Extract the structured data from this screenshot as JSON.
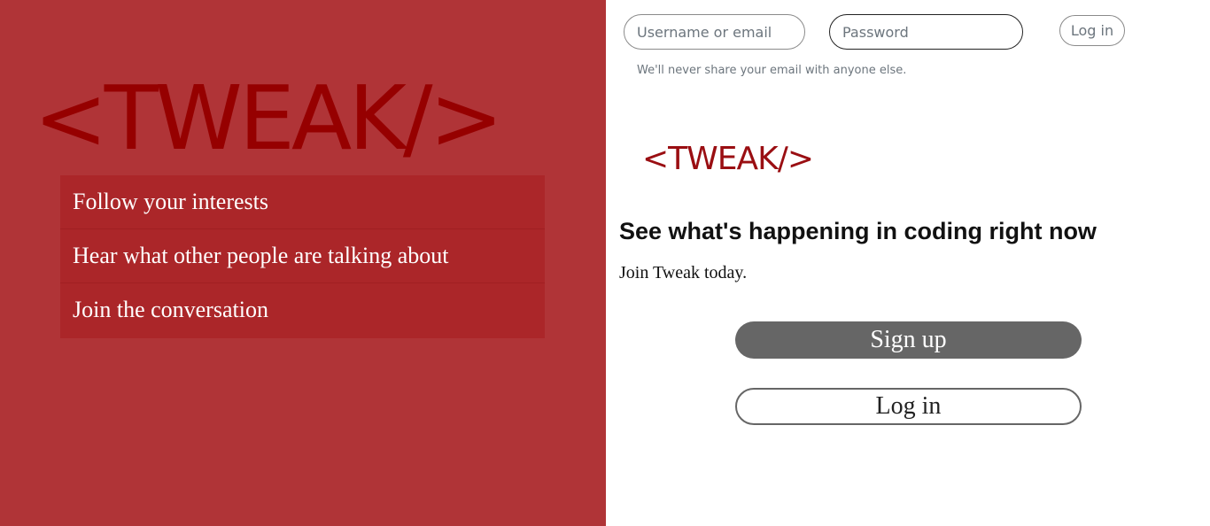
{
  "brand": {
    "logo_text": "<TWEAK/>",
    "logo_color": "#960000",
    "panel_color": "#b03437"
  },
  "features": [
    {
      "label": "Follow your interests"
    },
    {
      "label": "Hear what other people are talking about"
    },
    {
      "label": "Join the conversation"
    }
  ],
  "login_form": {
    "username_placeholder": "Username or email",
    "password_placeholder": "Password",
    "login_label": "Log in",
    "hint": "We'll never share your email with anyone else."
  },
  "main": {
    "headline": "See what's happening in coding right now",
    "subline": "Join Tweak today.",
    "signup_label": "Sign up",
    "login_label": "Log in"
  }
}
